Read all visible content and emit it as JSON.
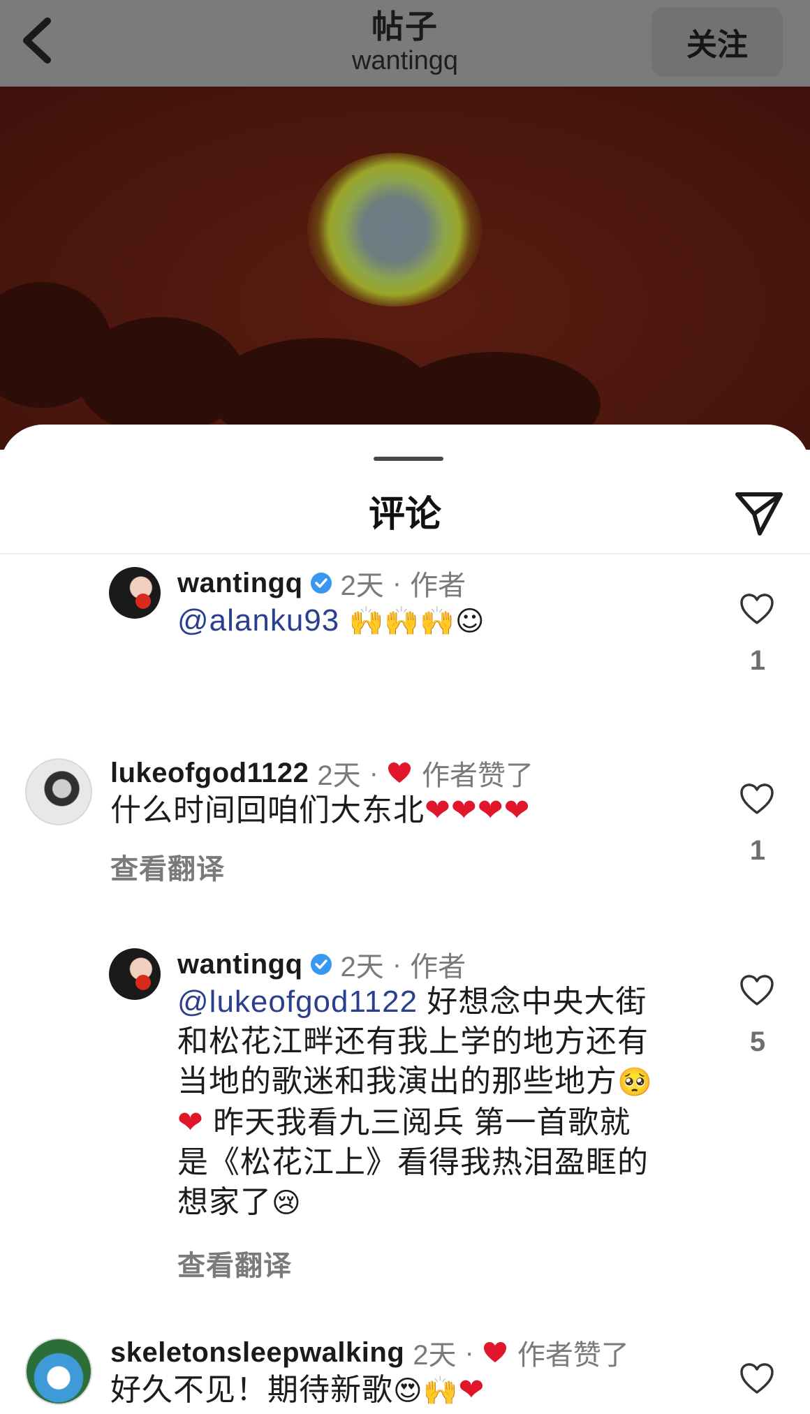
{
  "header": {
    "title": "帖子",
    "subtitle": "wantingq",
    "follow_label": "关注"
  },
  "sheet": {
    "title": "评论"
  },
  "comments": [
    {
      "username": "wantingq",
      "verified": true,
      "time": "2天",
      "badge": "作者",
      "mention": "@alanku93",
      "emojis": "🙌🙌🙌☺",
      "likes": "1"
    },
    {
      "username": "lukeofgod1122",
      "time": "2天",
      "badge": "作者赞了",
      "text": "什么时间回咱们大东北",
      "emojis": "❤❤❤❤",
      "translate": "查看翻译",
      "likes": "1"
    },
    {
      "username": "wantingq",
      "verified": true,
      "time": "2天",
      "badge": "作者",
      "mention": "@lukeofgod1122",
      "line1": " 好想念中央大街",
      "line2": "和松花江畔还有我上学的地方还有",
      "line3": "当地的歌迷和我演出的那些地方",
      "line3_emoji": "🥺",
      "line4_emoji": "❤",
      "line4": " 昨天我看九三阅兵 第一首歌就",
      "line5": "是《松花江上》看得我热泪盈眶的",
      "line6": "想家了",
      "line6_emoji": "😢",
      "translate": "查看翻译",
      "likes": "5"
    },
    {
      "username": "skeletonsleepwalking",
      "time": "2天",
      "badge": "作者赞了",
      "text": "好久不见！期待新歌",
      "emojis": "😍🙌",
      "heart": "❤"
    }
  ],
  "colors": {
    "mention": "#2b3f8f",
    "like_heart": "#e0162b",
    "verified": "#3897f0"
  },
  "icons": [
    "back-icon",
    "share-icon",
    "verified-icon",
    "like-icon",
    "liked-heart-icon"
  ]
}
